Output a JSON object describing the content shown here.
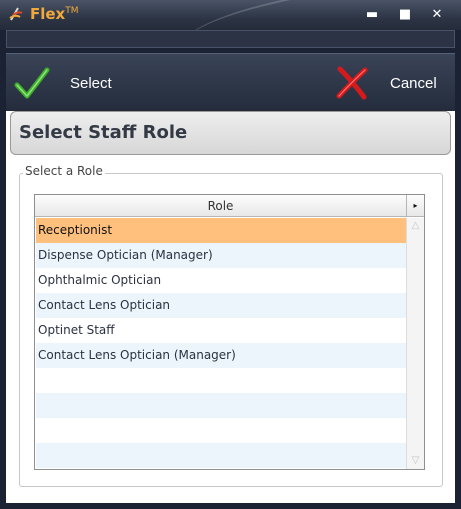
{
  "window": {
    "title": "Flex",
    "trademark": "TM",
    "controls": {
      "minimize": "▬",
      "maximize": "■",
      "close": "✕"
    }
  },
  "toolbar": {
    "select_label": "Select",
    "cancel_label": "Cancel"
  },
  "header": {
    "title": "Select Staff Role"
  },
  "group": {
    "legend": "Select a Role"
  },
  "grid": {
    "column_header": "Role",
    "corner_glyph": "▸",
    "rows": [
      "Receptionist",
      "Dispense Optician (Manager)",
      "Ophthalmic Optician",
      "Contact Lens Optician",
      "Optinet Staff",
      "Contact Lens Optician (Manager)",
      "",
      "",
      "",
      ""
    ],
    "selected_index": 0
  },
  "colors": {
    "title_accent": "#f2a93b",
    "selected_row": "#ffc07e",
    "alt_row": "#edf5fc",
    "select_icon": "#3db02a",
    "cancel_icon": "#d41a1a"
  },
  "icons": {
    "app": "flex-logo-icon",
    "select": "checkmark-icon",
    "cancel": "x-mark-icon"
  }
}
